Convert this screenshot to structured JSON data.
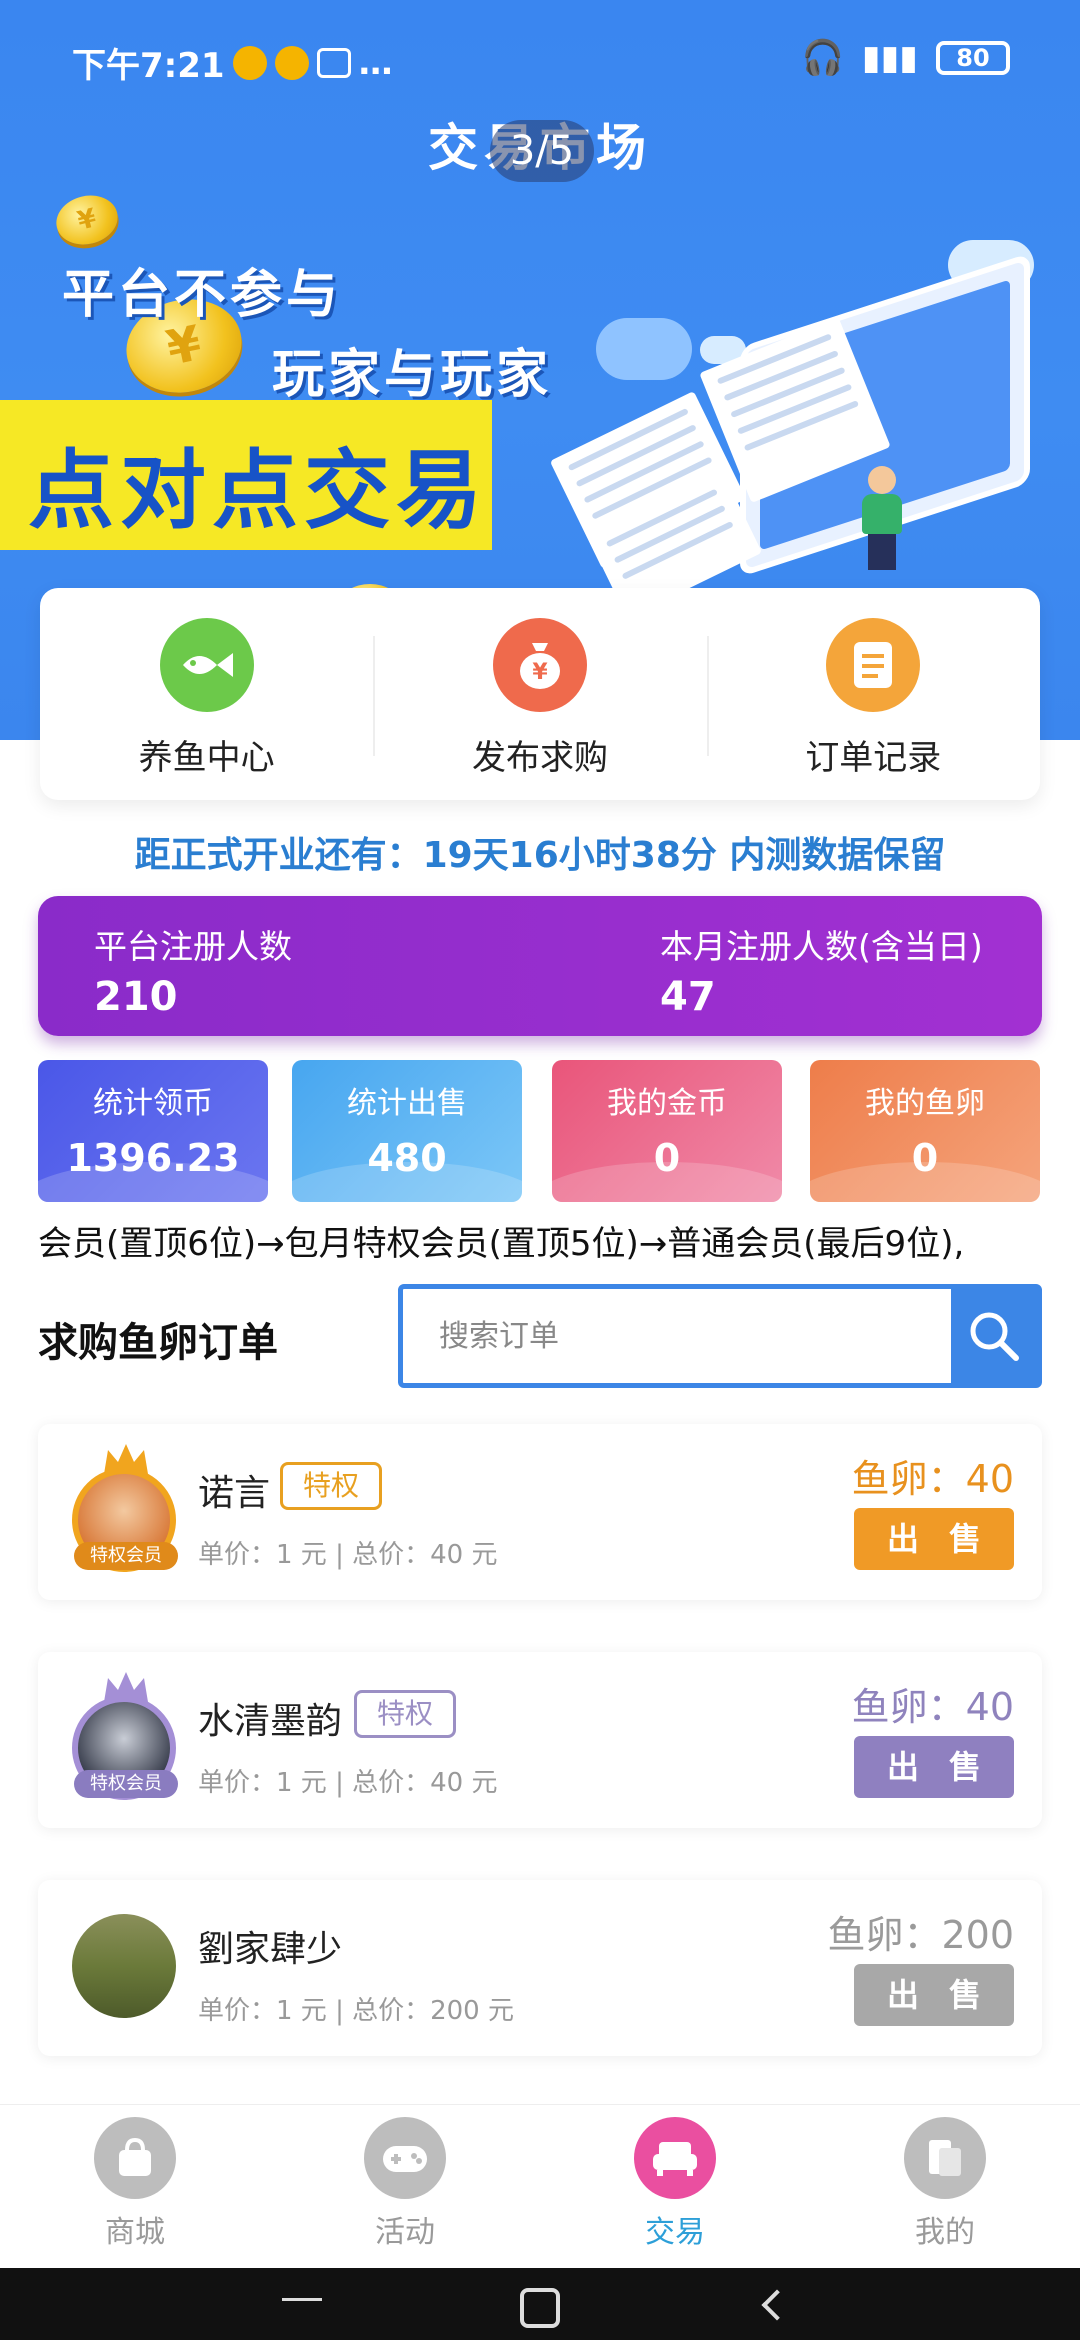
{
  "status_bar": {
    "time": "下午7:21",
    "signal": "HD",
    "more": "…",
    "battery": "80"
  },
  "header": {
    "title": "交易市场",
    "banner_indicator": "3/5"
  },
  "banner": {
    "slogan_line1": "平台不参与",
    "slogan_line2": "玩家与玩家",
    "slogan_line3": "点对点交易"
  },
  "quick_actions": [
    {
      "label": "养鱼中心",
      "icon": "fish-icon",
      "color": "#6cc94a"
    },
    {
      "label": "发布求购",
      "icon": "money-bag-icon",
      "color": "#ef6a4c"
    },
    {
      "label": "订单记录",
      "icon": "document-icon",
      "color": "#f4a53a"
    }
  ],
  "countdown": {
    "text": "距正式开业还有：19天16小时38分  内测数据保留"
  },
  "registration": {
    "platform_label": "平台注册人数",
    "platform_value": "210",
    "month_label": "本月注册人数(含当日)",
    "month_value": "47"
  },
  "stats": [
    {
      "label": "统计领币",
      "value": "1396.23",
      "color_from": "#4a57e8",
      "color_to": "#6b76f0"
    },
    {
      "label": "统计出售",
      "value": "480",
      "color_from": "#47a6f0",
      "color_to": "#7cc7f7"
    },
    {
      "label": "我的金币",
      "value": "0",
      "color_from": "#e9557a",
      "color_to": "#f08aa8"
    },
    {
      "label": "我的鱼卵",
      "value": "0",
      "color_from": "#ee7d4a",
      "color_to": "#f5a47c"
    }
  ],
  "marquee": {
    "text": "会员(置顶6位)→包月特权会员(置顶5位)→普通会员(最后9位),"
  },
  "orders_section": {
    "title": "求购鱼卵订单",
    "search_placeholder": "搜索订单"
  },
  "orders": [
    {
      "name": "诺言",
      "badge": "特权",
      "badge_color": "#e8a020",
      "member_tag": "特权会员",
      "tag_color": "#e08a1a",
      "crown_color": "#f1a51e",
      "price_line": "单价：1 元  |  总价：40 元",
      "egg_label": "鱼卵：",
      "egg_value": "40",
      "egg_color": "#e8911e",
      "sell_label": "出售",
      "sell_color": "#f09a26"
    },
    {
      "name": "水清墨韵",
      "badge": "特权",
      "badge_color": "#9b8fc4",
      "member_tag": "特权会员",
      "tag_color": "#8a7cc0",
      "crown_color": "#a48fd6",
      "price_line": "单价：1 元  |  总价：40 元",
      "egg_label": "鱼卵：",
      "egg_value": "40",
      "egg_color": "#8f83bd",
      "sell_label": "出售",
      "sell_color": "#8f80c0"
    },
    {
      "name": "劉家肆少",
      "badge": "",
      "price_line": "单价：1 元  |  总价：200 元",
      "egg_label": "鱼卵：",
      "egg_value": "200",
      "egg_color": "#9a9a9a",
      "sell_label": "出售",
      "sell_color": "#a8a8a8"
    }
  ],
  "bottom_nav": [
    {
      "label": "商城",
      "icon": "shopping-bag-icon",
      "active": false
    },
    {
      "label": "活动",
      "icon": "gamepad-icon",
      "active": false
    },
    {
      "label": "交易",
      "icon": "sofa-icon",
      "active": true
    },
    {
      "label": "我的",
      "icon": "profile-icon",
      "active": false
    }
  ]
}
